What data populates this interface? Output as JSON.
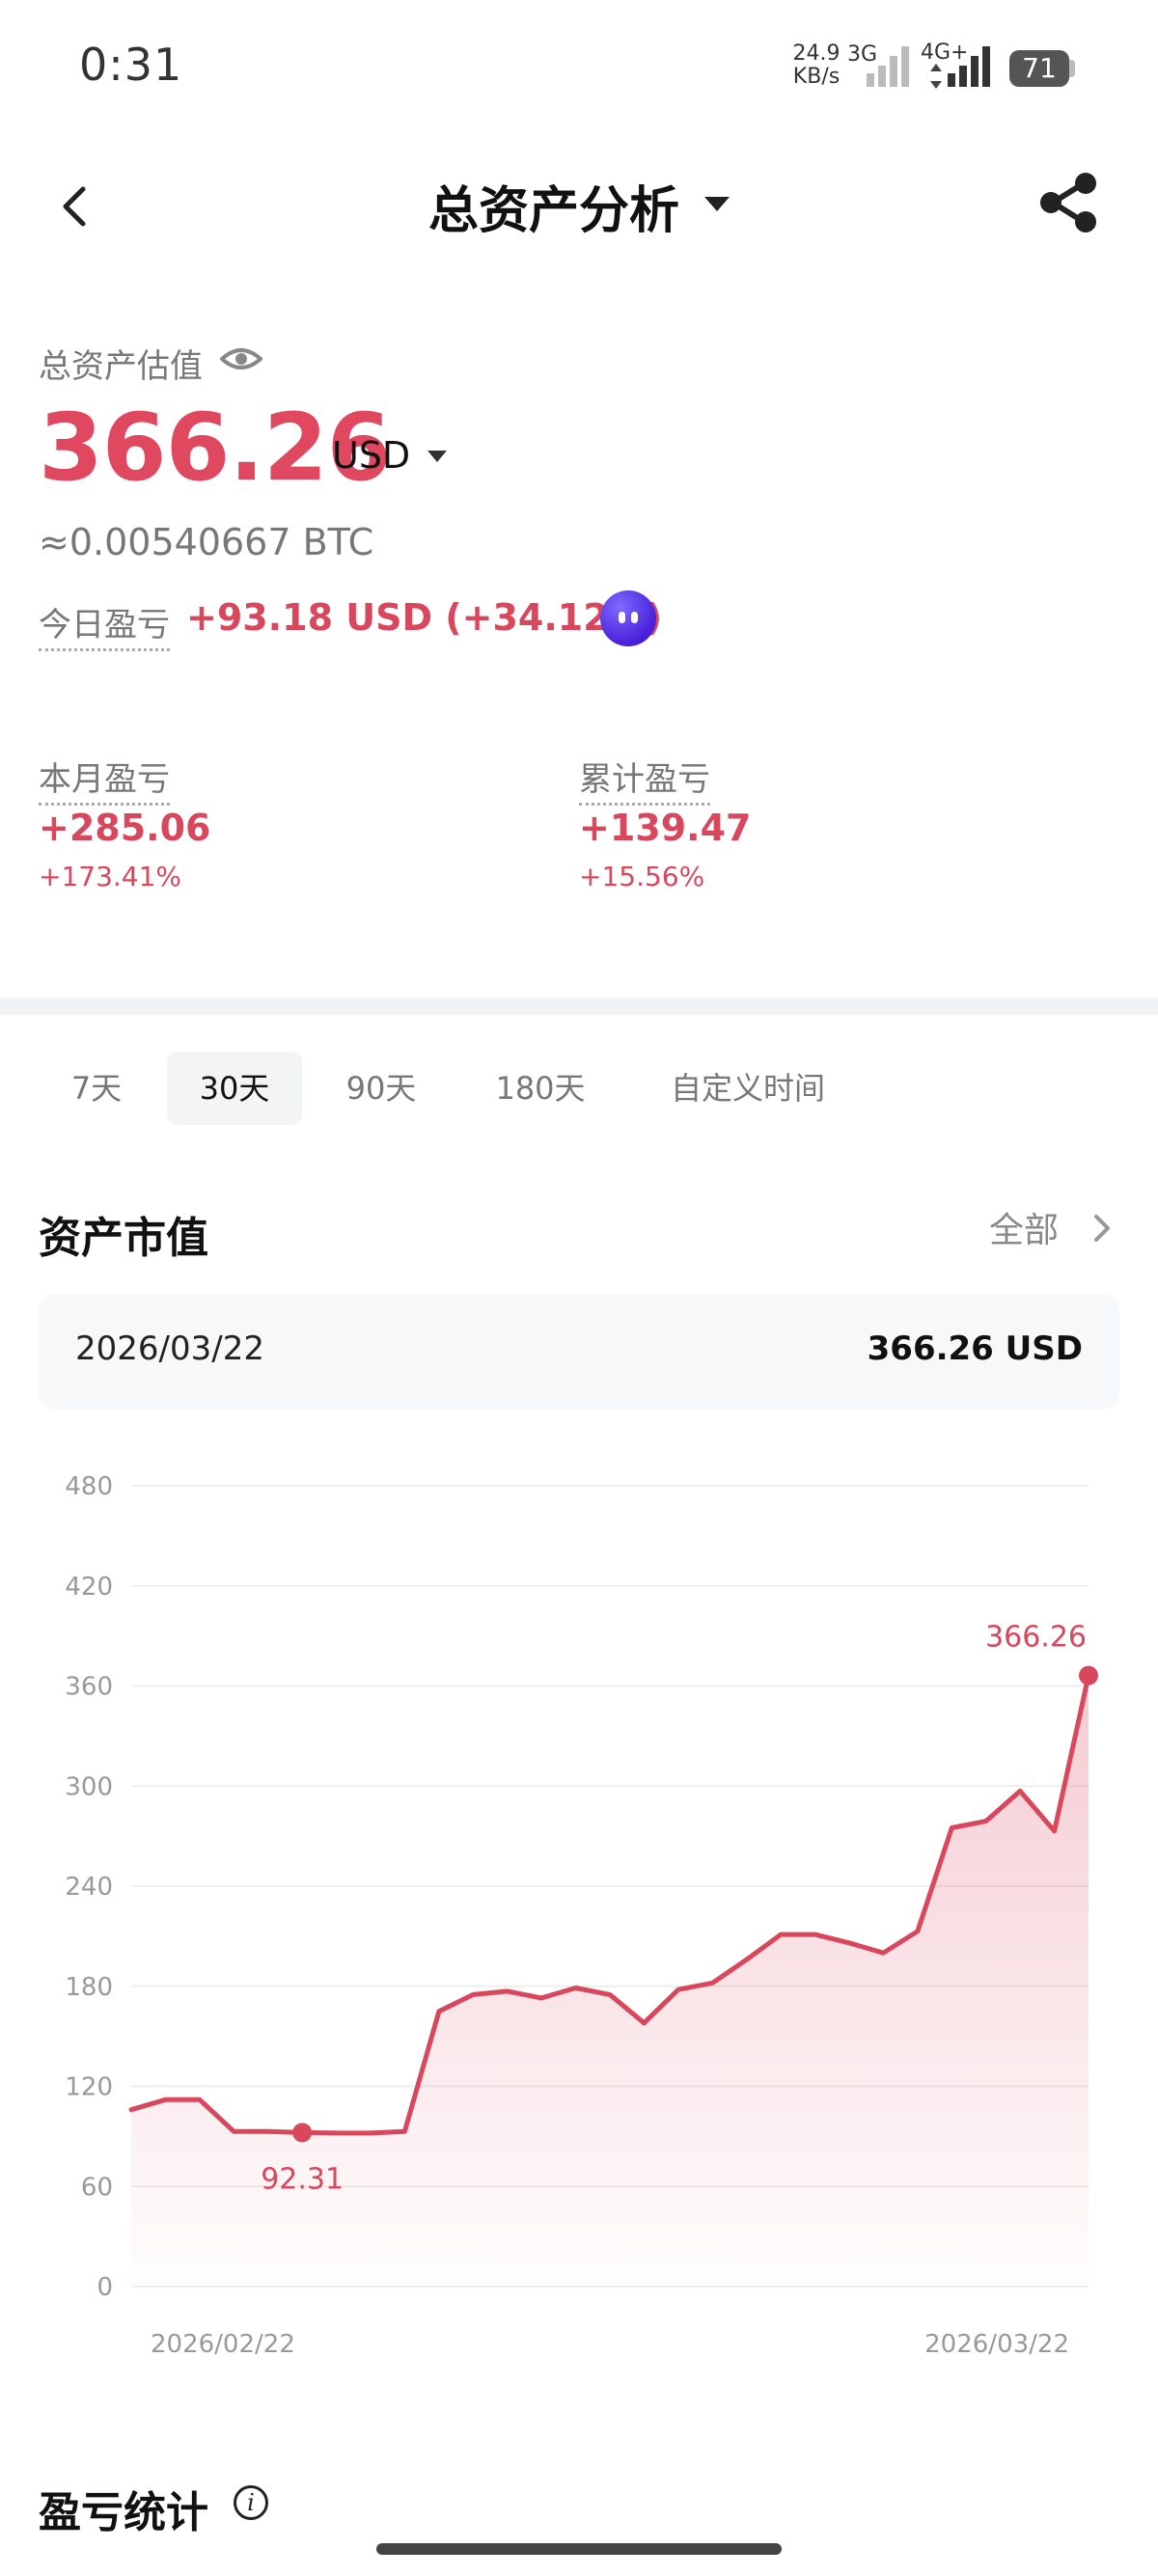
{
  "status_bar": {
    "time": "0:31",
    "net_speed_value": "24.9",
    "net_speed_unit": "KB/s",
    "signal1_label": "3G",
    "signal2_label": "4G+",
    "battery": "71"
  },
  "header": {
    "title": "总资产分析"
  },
  "summary": {
    "label": "总资产估值",
    "value": "366.26",
    "currency": "USD",
    "btc_equiv": "≈0.00540667 BTC",
    "today_label": "今日盈亏",
    "today_value": "+93.18 USD (+34.12%)",
    "month_label": "本月盈亏",
    "month_value": "+285.06",
    "month_pct": "+173.41%",
    "total_label": "累计盈亏",
    "total_value": "+139.47",
    "total_pct": "+15.56%"
  },
  "tabs": [
    {
      "label": "7天",
      "active": false
    },
    {
      "label": "30天",
      "active": true
    },
    {
      "label": "90天",
      "active": false
    },
    {
      "label": "180天",
      "active": false
    },
    {
      "label": "自定义时间",
      "active": false
    }
  ],
  "market_value": {
    "section_title": "资产市值",
    "all_label": "全部",
    "selected_date": "2026/03/22",
    "selected_value": "366.26 USD"
  },
  "chart_data": {
    "type": "area",
    "title": "",
    "xlabel": "",
    "ylabel": "",
    "ylim": [
      0,
      480
    ],
    "yticks": [
      0,
      60,
      120,
      180,
      240,
      300,
      360,
      420,
      480
    ],
    "x_tick_labels": [
      "2026/02/22",
      "2026/03/22"
    ],
    "grid": true,
    "line_color": "#d9475c",
    "series": [
      {
        "values": [
          106,
          112,
          112,
          93,
          93,
          92.31,
          92,
          92,
          93,
          165,
          175,
          177,
          173,
          179,
          175,
          158,
          178,
          182,
          196,
          211,
          211,
          206,
          200,
          213,
          275,
          279,
          297,
          273,
          366.26
        ]
      }
    ],
    "annotations": [
      {
        "index": 5,
        "label": "92.31"
      },
      {
        "index": 28,
        "label": "366.26"
      }
    ]
  },
  "pnl": {
    "section_title": "盈亏统计",
    "info_glyph": "i"
  }
}
